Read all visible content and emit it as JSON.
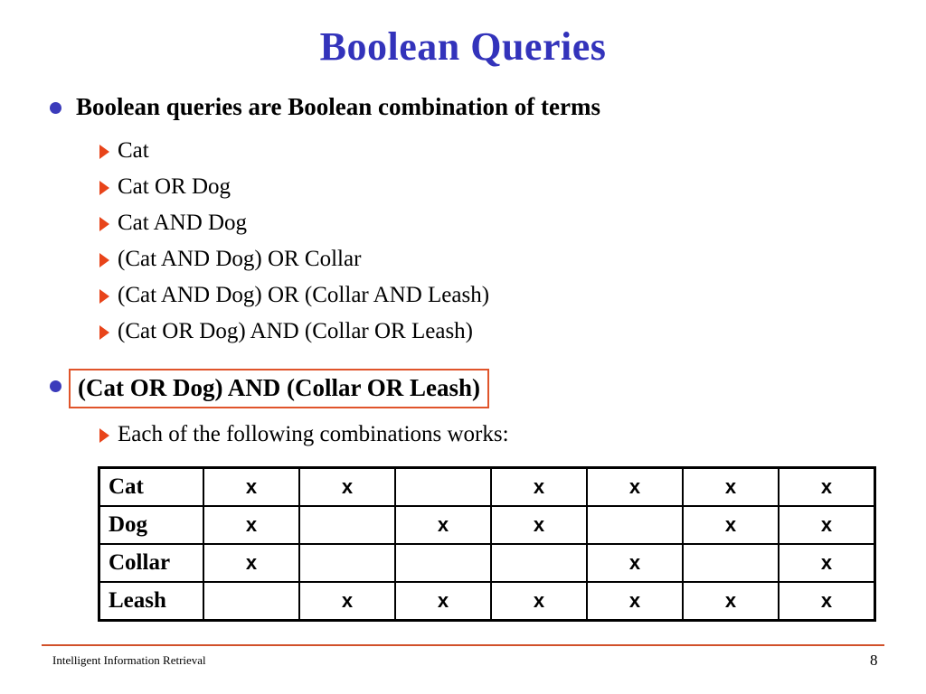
{
  "slide": {
    "title": "Boolean Queries",
    "title_color": "#3333bb",
    "bullet_color": "#3b3bbb",
    "marker_color": "#e8441a",
    "highlight_border_color": "#e0542a",
    "footer_rule_color": "#d1512a"
  },
  "main_bullet_1": {
    "text": "Boolean queries are Boolean combination of terms",
    "sub_items": [
      {
        "text": "Cat"
      },
      {
        "text": "Cat OR Dog"
      },
      {
        "text": "Cat AND Dog"
      },
      {
        "text": "(Cat AND Dog) OR Collar"
      },
      {
        "text": "(Cat AND Dog) OR (Collar AND Leash)"
      },
      {
        "text": "(Cat OR Dog) AND (Collar OR Leash)"
      }
    ]
  },
  "main_bullet_2": {
    "text": "(Cat OR Dog) AND (Collar OR Leash)",
    "highlighted": true,
    "sub_items": [
      {
        "text": "Each of the following combinations works:"
      }
    ]
  },
  "combination_table": {
    "mark": "x",
    "blank": "",
    "row_labels": [
      "Cat",
      "Dog",
      "Collar",
      "Leash"
    ],
    "rows": [
      {
        "label": "Cat",
        "cells": [
          "x",
          "x",
          "",
          "x",
          "x",
          "x",
          "x"
        ]
      },
      {
        "label": "Dog",
        "cells": [
          "x",
          "",
          "x",
          "x",
          "",
          "x",
          "x"
        ]
      },
      {
        "label": "Collar",
        "cells": [
          "x",
          "",
          "",
          "",
          "x",
          "",
          "x"
        ]
      },
      {
        "label": "Leash",
        "cells": [
          "",
          "x",
          "x",
          "x",
          "x",
          "x",
          "x"
        ]
      }
    ]
  },
  "footer": {
    "label": "Intelligent Information Retrieval",
    "page_number": "8"
  }
}
